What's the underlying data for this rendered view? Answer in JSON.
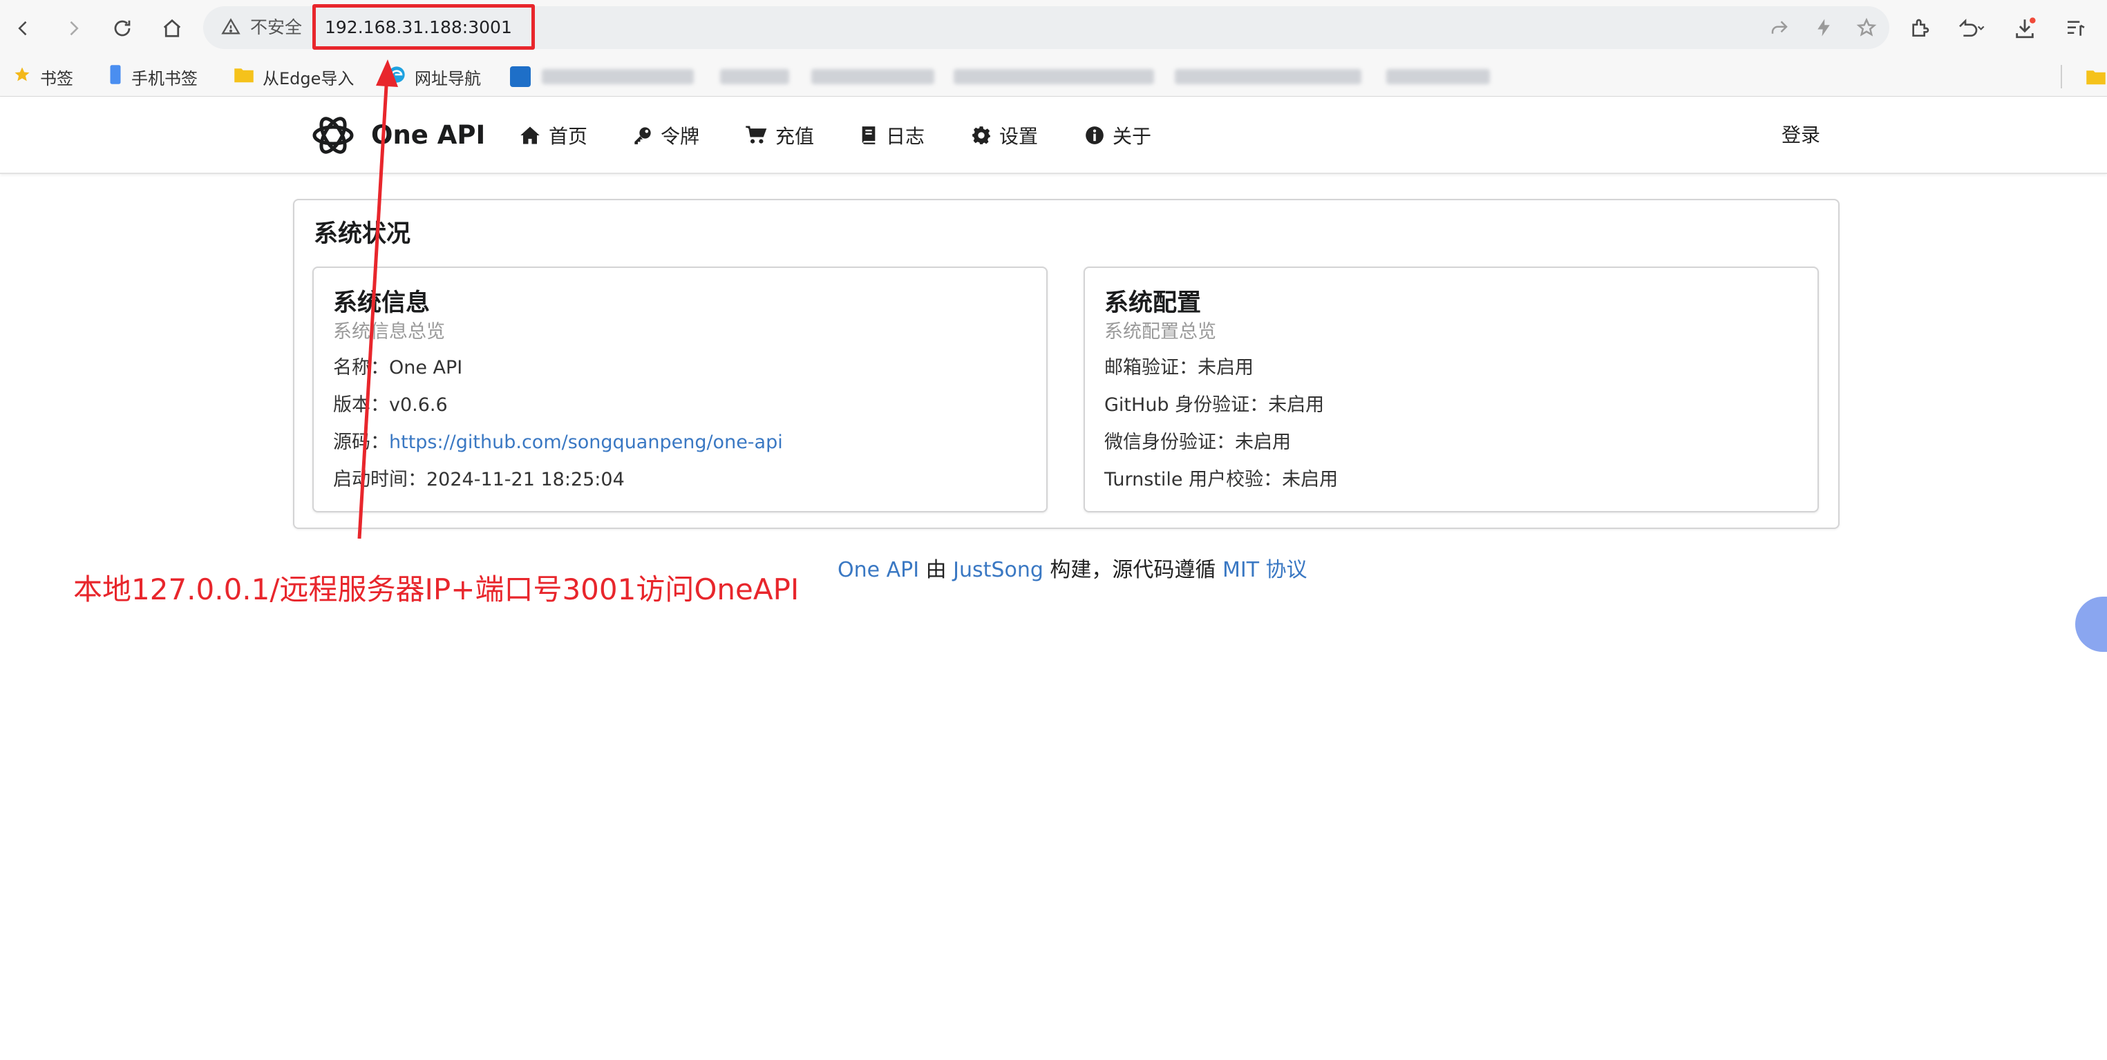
{
  "browser": {
    "insecure_label": "不安全",
    "url": "192.168.31.188:3001",
    "nav_icons": [
      "back-icon",
      "forward-icon",
      "reload-icon",
      "home-icon"
    ],
    "right_icons": [
      "extensions-icon",
      "history-icon",
      "downloads-icon",
      "reading-list-icon"
    ],
    "bookmarks": [
      {
        "label": "书签",
        "icon": "star-icon"
      },
      {
        "label": "手机书签",
        "icon": "phone-icon"
      },
      {
        "label": "从Edge导入",
        "icon": "folder-icon"
      },
      {
        "label": "网址导航",
        "icon": "edge-icon"
      }
    ]
  },
  "app": {
    "brand": "One API",
    "nav": [
      {
        "label": "首页",
        "icon": "home-icon"
      },
      {
        "label": "令牌",
        "icon": "key-icon"
      },
      {
        "label": "充值",
        "icon": "cart-icon"
      },
      {
        "label": "日志",
        "icon": "book-icon"
      },
      {
        "label": "设置",
        "icon": "gear-icon"
      },
      {
        "label": "关于",
        "icon": "info-icon"
      }
    ],
    "login": "登录"
  },
  "status": {
    "title": "系统状况",
    "info": {
      "title": "系统信息",
      "subtitle": "系统信息总览",
      "name_label": "名称：",
      "name": "One API",
      "version_label": "版本：",
      "version": "v0.6.6",
      "source_label": "源码：",
      "source": "https://github.com/songquanpeng/one-api",
      "start_label": "启动时间：",
      "start_time": "2024-11-21 18:25:04"
    },
    "config": {
      "title": "系统配置",
      "subtitle": "系统配置总览",
      "rows": [
        "邮箱验证：未启用",
        "GitHub 身份验证：未启用",
        "微信身份验证：未启用",
        "Turnstile 用户校验：未启用"
      ]
    }
  },
  "footer": {
    "project": "One API",
    "by": " 由 ",
    "author": "JustSong",
    "mid": " 构建，源代码遵循 ",
    "license": "MIT 协议"
  },
  "annotation": "本地127.0.0.1/远程服务器IP+端口号3001访问OneAPI",
  "colors": {
    "accent_link": "#3a78c3",
    "annotation_red": "#e8262c"
  }
}
